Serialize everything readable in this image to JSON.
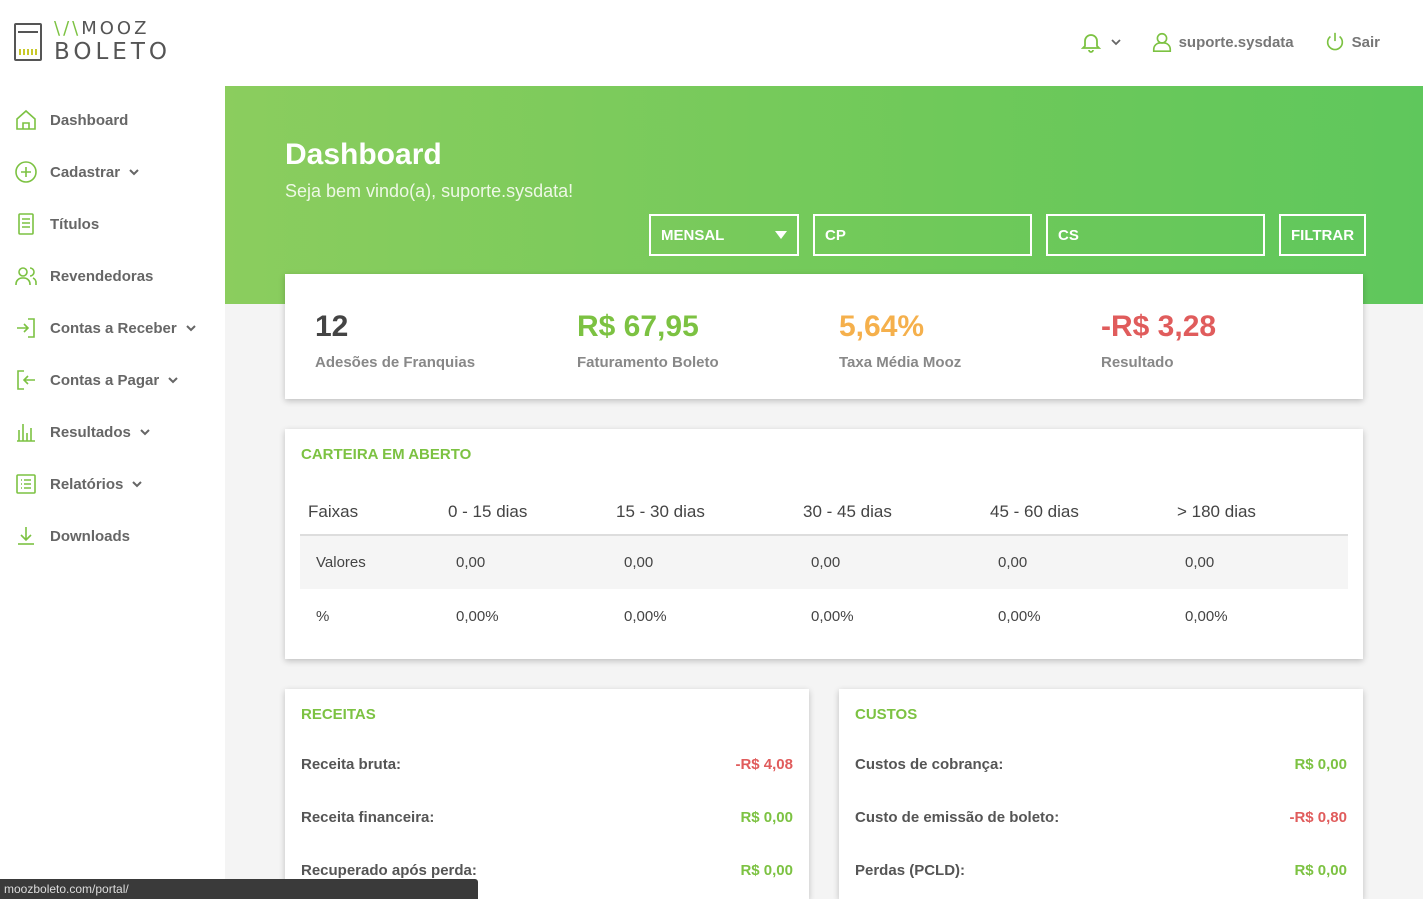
{
  "brand": {
    "top": "MOOZ",
    "bottom": "BOLETO"
  },
  "header": {
    "user": "suporte.sysdata",
    "logout": "Sair"
  },
  "sidebar": {
    "items": [
      {
        "label": "Dashboard"
      },
      {
        "label": "Cadastrar"
      },
      {
        "label": "Títulos"
      },
      {
        "label": "Revendedoras"
      },
      {
        "label": "Contas a Receber"
      },
      {
        "label": "Contas a Pagar"
      },
      {
        "label": "Resultados"
      },
      {
        "label": "Relatórios"
      },
      {
        "label": "Downloads"
      }
    ]
  },
  "banner": {
    "title": "Dashboard",
    "welcome": "Seja bem vindo(a), suporte.sysdata!",
    "period": "MENSAL",
    "cp_placeholder": "CP",
    "cs_placeholder": "CS",
    "filter_label": "FILTRAR"
  },
  "stats": [
    {
      "value": "12",
      "label": "Adesões de Franquias",
      "color": "#444444"
    },
    {
      "value": "R$ 67,95",
      "label": "Faturamento Boleto",
      "color": "#7cc242"
    },
    {
      "value": "5,64%",
      "label": "Taxa Média Mooz",
      "color": "#f5b04c"
    },
    {
      "value": "-R$ 3,28",
      "label": "Resultado",
      "color": "#e05c5c"
    }
  ],
  "carteira": {
    "title": "CARTEIRA EM ABERTO",
    "headers": [
      "Faixas",
      "0 - 15 dias",
      "15 - 30 dias",
      "30 - 45 dias",
      "45 - 60 dias",
      "> 180 dias"
    ],
    "rows": [
      [
        "Valores",
        "0,00",
        "0,00",
        "0,00",
        "0,00",
        "0,00"
      ],
      [
        "%",
        "0,00%",
        "0,00%",
        "0,00%",
        "0,00%",
        "0,00%"
      ]
    ]
  },
  "receitas": {
    "title": "RECEITAS",
    "rows": [
      {
        "label": "Receita bruta:",
        "value": "-R$ 4,08"
      },
      {
        "label": "Receita financeira:",
        "value": "R$ 0,00"
      },
      {
        "label": "Recuperado após perda:",
        "value": "R$ 0,00"
      }
    ]
  },
  "custos": {
    "title": "CUSTOS",
    "rows": [
      {
        "label": "Custos de cobrança:",
        "value": "R$ 0,00"
      },
      {
        "label": "Custo de emissão de boleto:",
        "value": "-R$ 0,80"
      },
      {
        "label": "Perdas (PCLD):",
        "value": "R$ 0,00"
      }
    ]
  },
  "statusbar": {
    "url": "moozboleto.com/portal/"
  }
}
